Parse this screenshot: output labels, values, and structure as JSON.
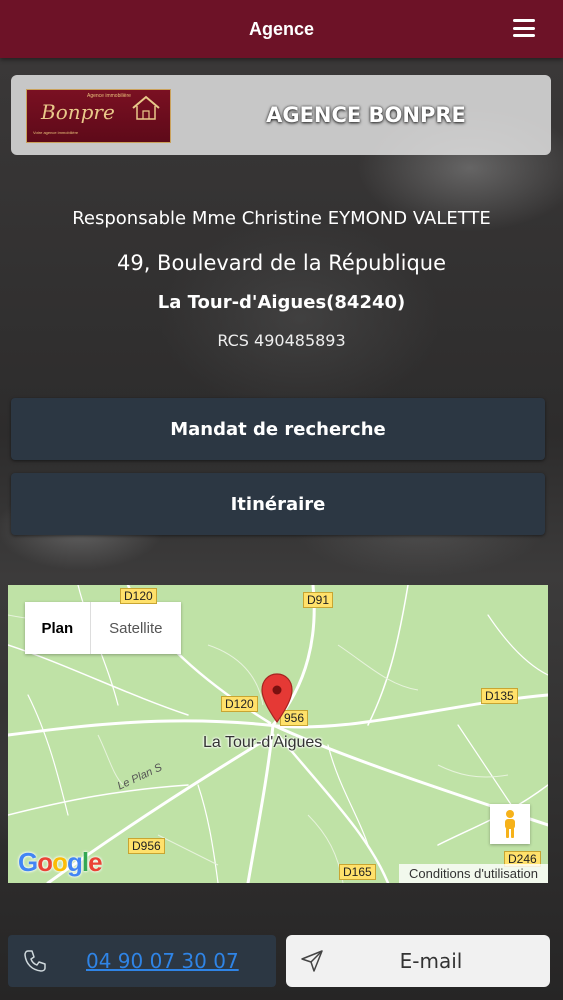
{
  "header": {
    "title": "Agence",
    "menu_icon": "hamburger-menu-icon"
  },
  "agency": {
    "name": "AGENCE BONPRE",
    "logo": {
      "brand": "Bonpre",
      "small_text": "Agence immobilière",
      "tagline": "Votre agence immobilière"
    }
  },
  "info": {
    "responsable": "Responsable Mme Christine EYMOND VALETTE",
    "address": "49, Boulevard de la République",
    "city": "La Tour-d'Aigues(84240)",
    "rcs": "RCS 490485893"
  },
  "buttons": {
    "mandat": "Mandat de recherche",
    "itineraire": "Itinéraire"
  },
  "map": {
    "tabs": {
      "plan": "Plan",
      "satellite": "Satellite"
    },
    "town": "La Tour-d'Aigues",
    "street": "Le Plan S",
    "roads": {
      "d120_top": "D120",
      "d91": "D91",
      "d120": "D120",
      "d956": "956",
      "d135": "D135",
      "d956_b": "D956",
      "d165": "D165",
      "d246": "D246"
    },
    "google": "Google",
    "terms": "Conditions d'utilisation"
  },
  "contact": {
    "phone": "04 90 07 30 07",
    "email_label": "E-mail"
  },
  "colors": {
    "header": "#6d1227",
    "button": "#2c3743",
    "map_land": "#bfe2a6",
    "road_label": "#ffe16b",
    "pin": "#e53935",
    "link": "#2f84e6"
  }
}
